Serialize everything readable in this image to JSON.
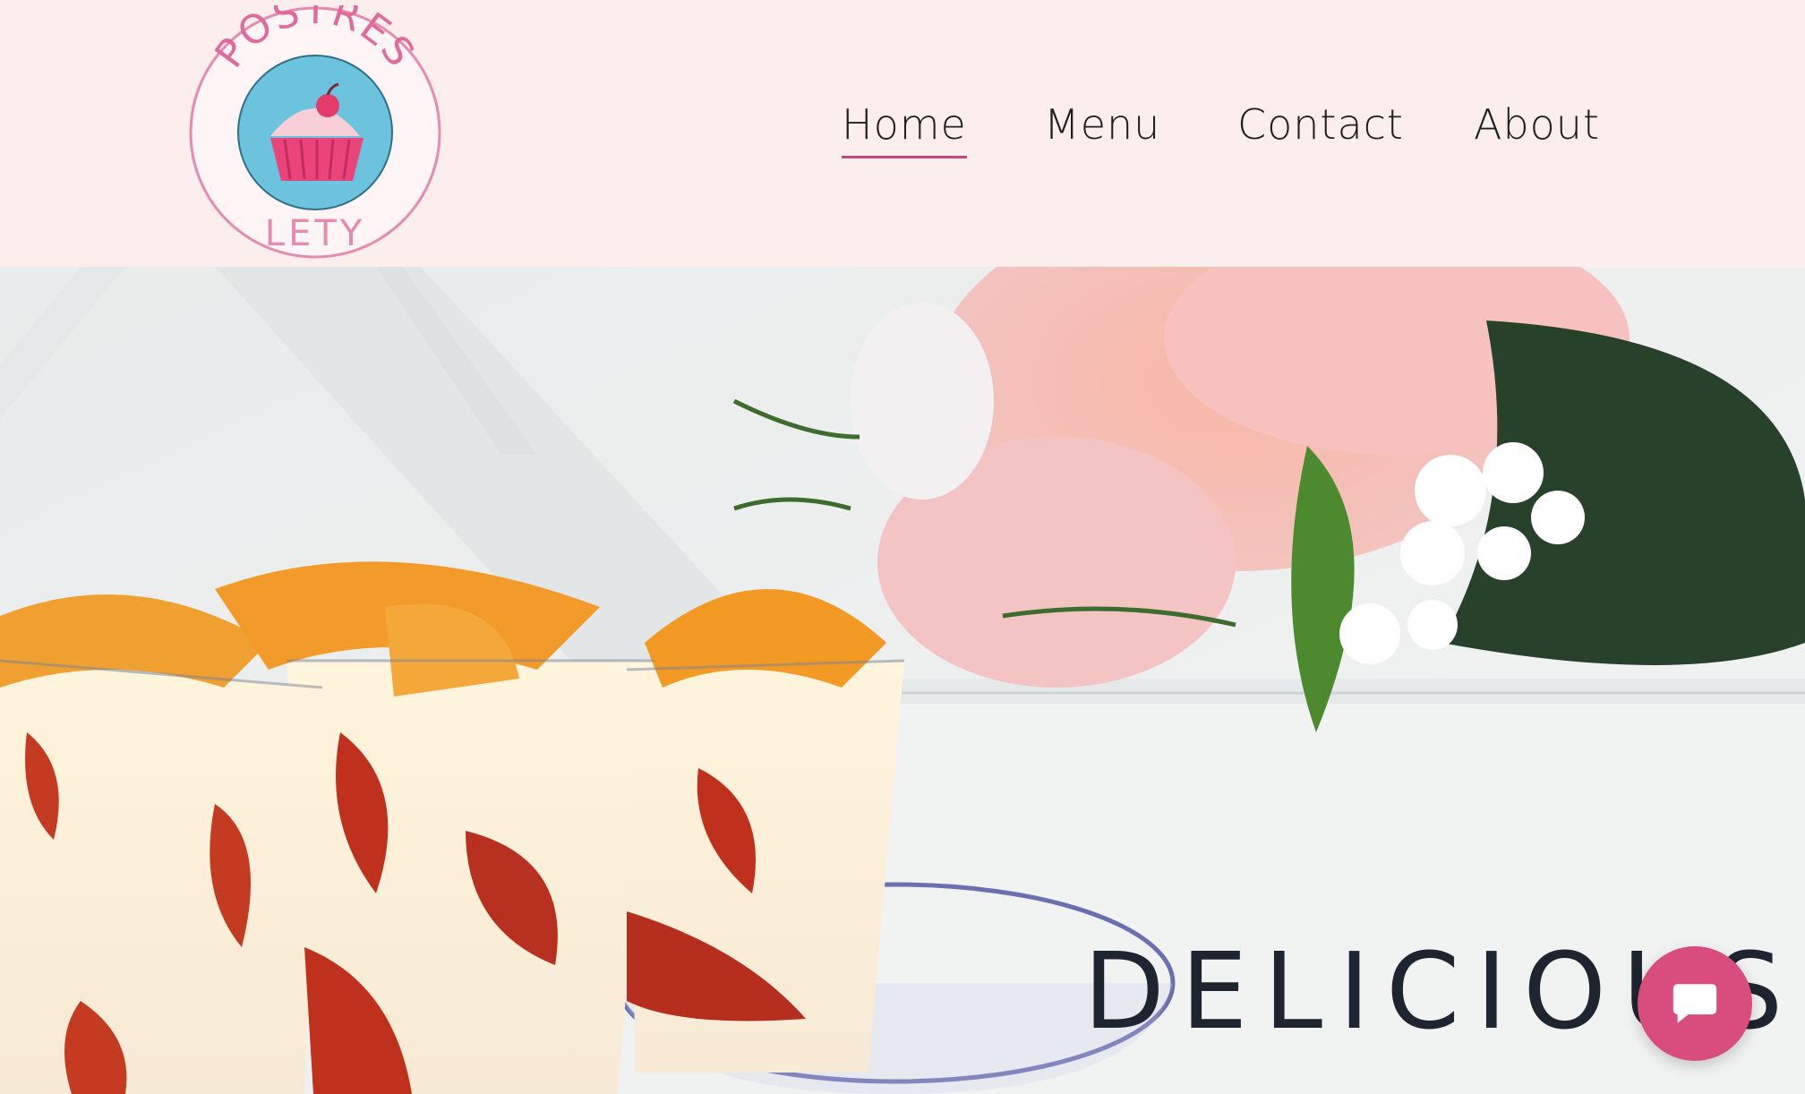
{
  "brand": {
    "logo_top_text": "POSTRES",
    "logo_bottom_text": "LETY"
  },
  "nav": {
    "items": [
      {
        "label": "Home",
        "active": true
      },
      {
        "label": "Menu",
        "active": false
      },
      {
        "label": "Contact",
        "active": false
      },
      {
        "label": "About",
        "active": false
      }
    ]
  },
  "hero": {
    "sign_text": "DELICIOUS!"
  },
  "chat": {
    "icon": "chat-bubble-icon"
  },
  "colors": {
    "header_bg": "#fdeeee",
    "accent": "#d84d7e",
    "logo_ring": "#e58bb0",
    "logo_circle": "#6cc3dd"
  }
}
